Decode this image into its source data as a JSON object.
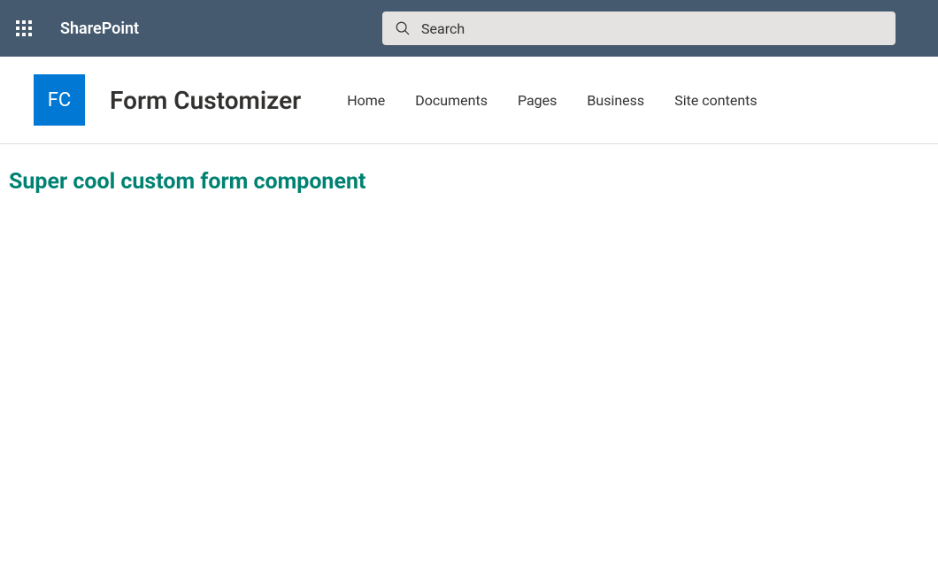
{
  "header": {
    "brand": "SharePoint",
    "search_placeholder": "Search"
  },
  "site": {
    "logo_initials": "FC",
    "title": "Form Customizer",
    "nav": [
      {
        "label": "Home"
      },
      {
        "label": "Documents"
      },
      {
        "label": "Pages"
      },
      {
        "label": "Business"
      },
      {
        "label": "Site contents"
      }
    ]
  },
  "content": {
    "heading": "Super cool custom form component"
  },
  "colors": {
    "top_bar": "#455a6f",
    "logo_bg": "#0078d4",
    "heading": "#008272"
  }
}
